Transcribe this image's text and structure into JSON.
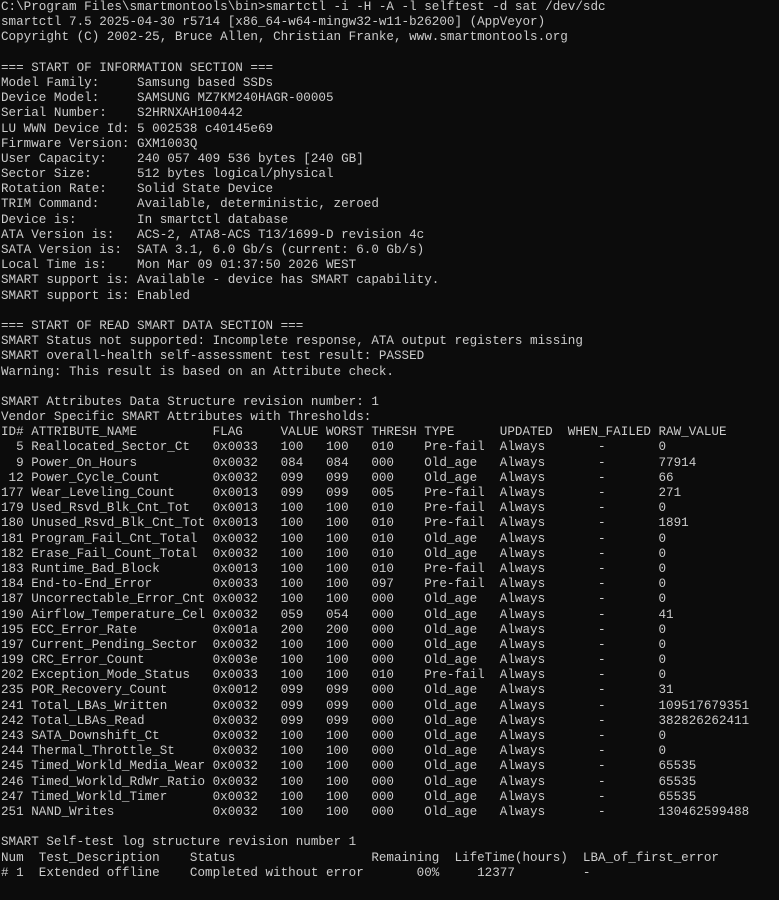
{
  "lines": [
    "C:\\Program Files\\smartmontools\\bin>smartctl -i -H -A -l selftest -d sat /dev/sdc",
    "smartctl 7.5 2025-04-30 r5714 [x86_64-w64-mingw32-w11-b26200] (AppVeyor)",
    "Copyright (C) 2002-25, Bruce Allen, Christian Franke, www.smartmontools.org",
    "",
    "=== START OF INFORMATION SECTION ===",
    "Model Family:     Samsung based SSDs",
    "Device Model:     SAMSUNG MZ7KM240HAGR-00005",
    "Serial Number:    S2HRNXAH100442",
    "LU WWN Device Id: 5 002538 c40145e69",
    "Firmware Version: GXM1003Q",
    "User Capacity:    240 057 409 536 bytes [240 GB]",
    "Sector Size:      512 bytes logical/physical",
    "Rotation Rate:    Solid State Device",
    "TRIM Command:     Available, deterministic, zeroed",
    "Device is:        In smartctl database",
    "ATA Version is:   ACS-2, ATA8-ACS T13/1699-D revision 4c",
    "SATA Version is:  SATA 3.1, 6.0 Gb/s (current: 6.0 Gb/s)",
    "Local Time is:    Mon Mar 09 01:37:50 2026 WEST",
    "SMART support is: Available - device has SMART capability.",
    "SMART support is: Enabled",
    "",
    "=== START OF READ SMART DATA SECTION ===",
    "SMART Status not supported: Incomplete response, ATA output registers missing",
    "SMART overall-health self-assessment test result: PASSED",
    "Warning: This result is based on an Attribute check.",
    "",
    "SMART Attributes Data Structure revision number: 1",
    "Vendor Specific SMART Attributes with Thresholds:",
    "ID# ATTRIBUTE_NAME          FLAG     VALUE WORST THRESH TYPE      UPDATED  WHEN_FAILED RAW_VALUE",
    "  5 Reallocated_Sector_Ct   0x0033   100   100   010    Pre-fail  Always       -       0",
    "  9 Power_On_Hours          0x0032   084   084   000    Old_age   Always       -       77914",
    " 12 Power_Cycle_Count       0x0032   099   099   000    Old_age   Always       -       66",
    "177 Wear_Leveling_Count     0x0013   099   099   005    Pre-fail  Always       -       271",
    "179 Used_Rsvd_Blk_Cnt_Tot   0x0013   100   100   010    Pre-fail  Always       -       0",
    "180 Unused_Rsvd_Blk_Cnt_Tot 0x0013   100   100   010    Pre-fail  Always       -       1891",
    "181 Program_Fail_Cnt_Total  0x0032   100   100   010    Old_age   Always       -       0",
    "182 Erase_Fail_Count_Total  0x0032   100   100   010    Old_age   Always       -       0",
    "183 Runtime_Bad_Block       0x0013   100   100   010    Pre-fail  Always       -       0",
    "184 End-to-End_Error        0x0033   100   100   097    Pre-fail  Always       -       0",
    "187 Uncorrectable_Error_Cnt 0x0032   100   100   000    Old_age   Always       -       0",
    "190 Airflow_Temperature_Cel 0x0032   059   054   000    Old_age   Always       -       41",
    "195 ECC_Error_Rate          0x001a   200   200   000    Old_age   Always       -       0",
    "197 Current_Pending_Sector  0x0032   100   100   000    Old_age   Always       -       0",
    "199 CRC_Error_Count         0x003e   100   100   000    Old_age   Always       -       0",
    "202 Exception_Mode_Status   0x0033   100   100   010    Pre-fail  Always       -       0",
    "235 POR_Recovery_Count      0x0012   099   099   000    Old_age   Always       -       31",
    "241 Total_LBAs_Written      0x0032   099   099   000    Old_age   Always       -       109517679351",
    "242 Total_LBAs_Read         0x0032   099   099   000    Old_age   Always       -       382826262411",
    "243 SATA_Downshift_Ct       0x0032   100   100   000    Old_age   Always       -       0",
    "244 Thermal_Throttle_St     0x0032   100   100   000    Old_age   Always       -       0",
    "245 Timed_Workld_Media_Wear 0x0032   100   100   000    Old_age   Always       -       65535",
    "246 Timed_Workld_RdWr_Ratio 0x0032   100   100   000    Old_age   Always       -       65535",
    "247 Timed_Workld_Timer      0x0032   100   100   000    Old_age   Always       -       65535",
    "251 NAND_Writes             0x0032   100   100   000    Old_age   Always       -       130462599488",
    "",
    "SMART Self-test log structure revision number 1",
    "Num  Test_Description    Status                  Remaining  LifeTime(hours)  LBA_of_first_error",
    "# 1  Extended offline    Completed without error       00%     12377         -"
  ]
}
